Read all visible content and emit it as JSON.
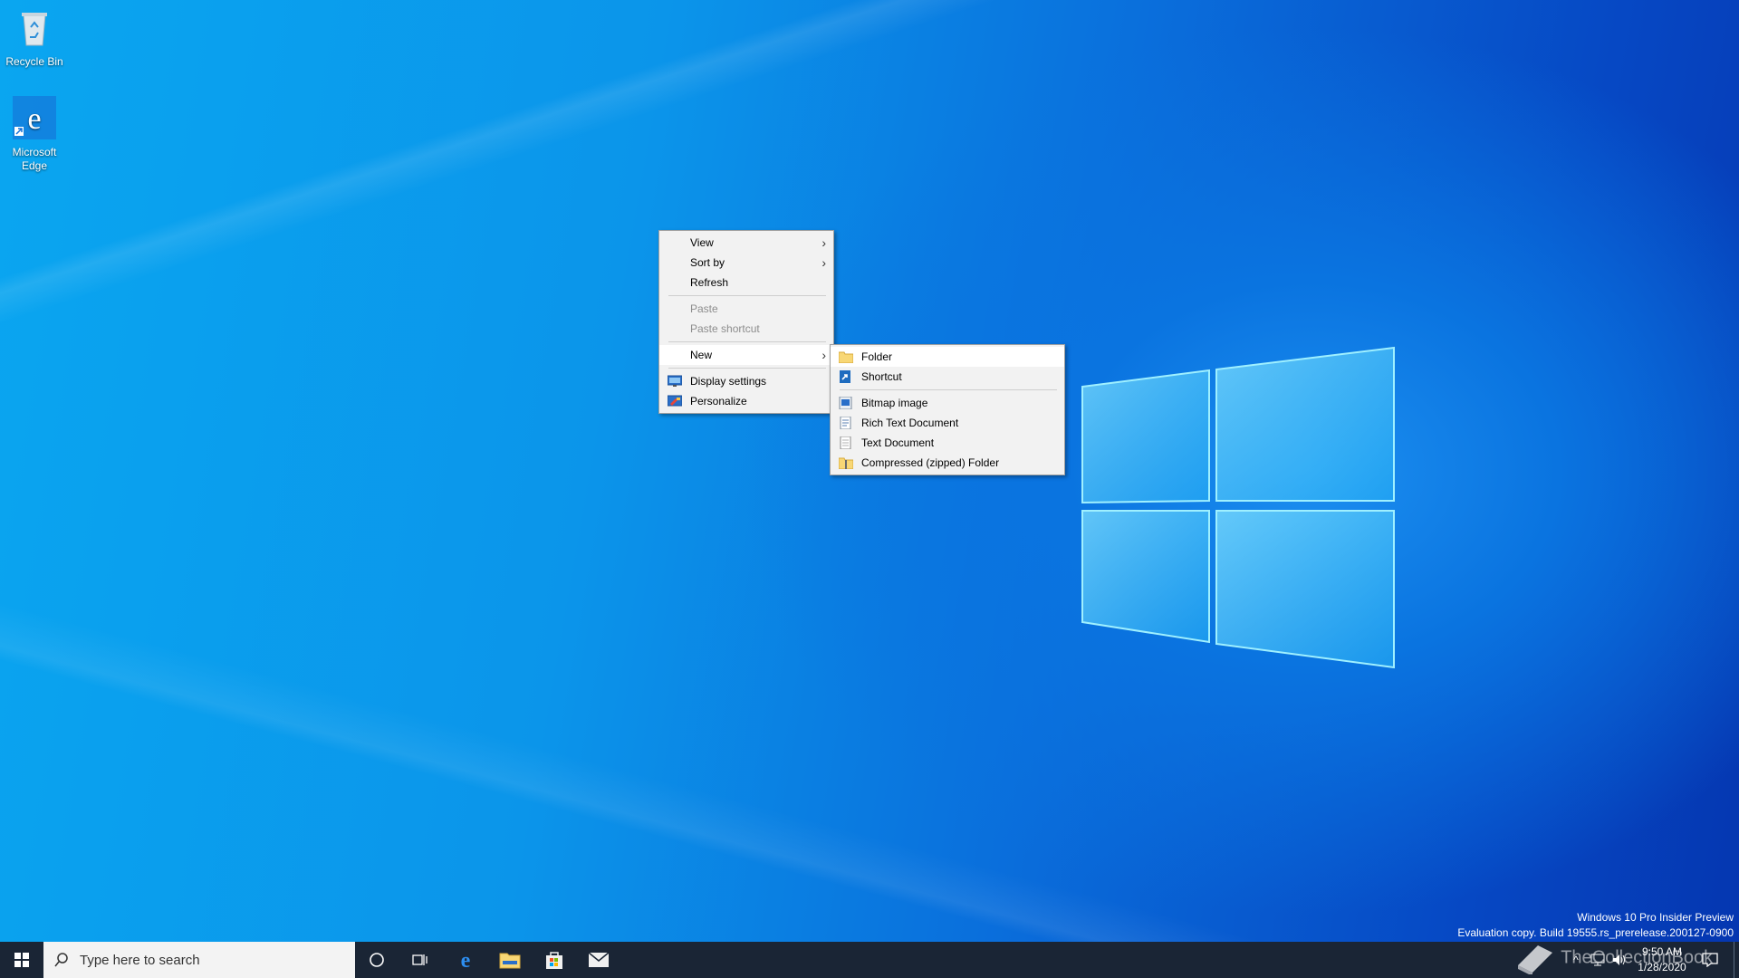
{
  "desktop": {
    "icons": [
      {
        "label": "Recycle Bin",
        "icon": "recycle-bin-icon"
      },
      {
        "label": "Microsoft Edge",
        "icon": "edge-icon"
      }
    ]
  },
  "context_menu": {
    "items": {
      "view": "View",
      "sort_by": "Sort by",
      "refresh": "Refresh",
      "paste": "Paste",
      "paste_shortcut": "Paste shortcut",
      "new": "New",
      "display_settings": "Display settings",
      "personalize": "Personalize"
    }
  },
  "new_submenu": {
    "items": {
      "folder": "Folder",
      "shortcut": "Shortcut",
      "bitmap": "Bitmap image",
      "rtf": "Rich Text Document",
      "text": "Text Document",
      "zip": "Compressed (zipped) Folder"
    }
  },
  "taskbar": {
    "search_placeholder": "Type here to search",
    "pinned": [
      "cortana-icon",
      "task-view-icon",
      "edge-icon",
      "file-explorer-icon",
      "store-icon",
      "mail-icon"
    ],
    "clock_time": "9:50 AM",
    "clock_date": "1/28/2020"
  },
  "watermark": {
    "line1": "Windows 10 Pro Insider Preview",
    "line2": "Evaluation copy. Build 19555.rs_prerelease.200127-0900"
  },
  "overlay_brand": "TheCollectionBook",
  "colors": {
    "taskbar": "#1a2535",
    "menu_bg": "#f2f2f2",
    "accent": "#0a74e0"
  }
}
